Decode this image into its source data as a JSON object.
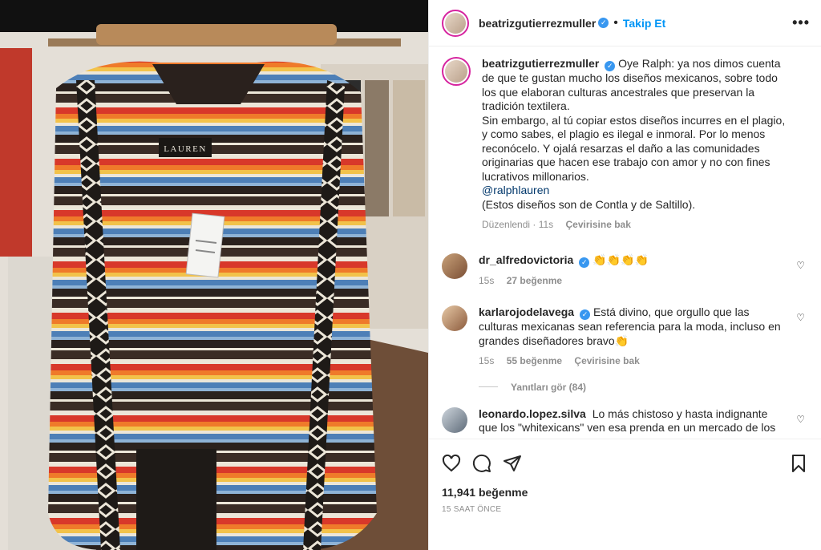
{
  "post": {
    "author": "beatrizgutierrezmuller",
    "follow_label": "Takip Et",
    "dot": "•",
    "more_label": "•••"
  },
  "photo": {
    "label_brand": "LAUREN",
    "hanger_text": "LAUREN RALPH LAUREN",
    "colors": {
      "red": "#d8382a",
      "orange": "#ef7a2a",
      "yellow": "#f2c24a",
      "blue": "#4d7fb7",
      "dark": "#2a211d",
      "cream": "#ece6d8"
    }
  },
  "caption": {
    "username": "beatrizgutierrezmuller",
    "paragraph1": "Oye Ralph: ya nos dimos cuenta de que te gustan mucho los diseños mexicanos, sobre todo los que elaboran culturas ancestrales que preservan la tradición textilera.",
    "paragraph2": "Sin embargo, al tú copiar estos diseños incurres en el plagio, y como sabes, el plagio es ilegal e inmoral. Por lo menos reconócelo. Y ojalá resarzas el daño a las comunidades originarias que hacen ese trabajo con amor y no con fines lucrativos millonarios.",
    "mention": "@ralphlauren",
    "paragraph3": "(Estos diseños son de Contla y de Saltillo).",
    "edited": "Düzenlendi · 11s",
    "translate": "Çevirisine bak"
  },
  "comments": [
    {
      "username": "dr_alfredovictoria",
      "text": "👏👏👏👏",
      "time": "15s",
      "likes": "27 beğenme",
      "translate": ""
    },
    {
      "username": "karlarojodelavega",
      "text": "Está divino, que orgullo que las culturas mexicanas sean referencia para la moda, incluso en grandes diseñadores bravo👏",
      "time": "15s",
      "likes": "55 beğenme",
      "translate": "Çevirisine bak"
    },
    {
      "username": "leonardo.lopez.silva",
      "text": "Lo más chistoso y hasta indignante que los \"whitexicans\" ven esa prenda en un mercado de los"
    }
  ],
  "replies_label": "Yanıtları gör (84)",
  "actions": {
    "likes": "11,941 beğenme",
    "time": "15 SAAT ÖNCE"
  },
  "accent": "#0095f6",
  "verified_color": "#3897f0",
  "icons": [
    "heart-icon",
    "comment-icon",
    "share-icon",
    "bookmark-icon",
    "verified-icon",
    "more-icon"
  ]
}
